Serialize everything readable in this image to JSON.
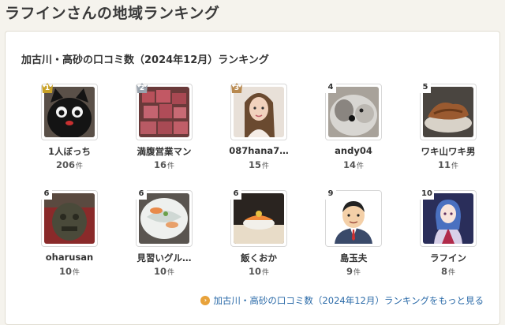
{
  "page": {
    "title": "ラフインさんの地域ランキング"
  },
  "panel": {
    "title": "加古川・高砂の口コミ数（2024年12月）ランキング",
    "more_link": "加古川・高砂の口コミ数（2024年12月）ランキングをもっと見る"
  },
  "colors": {
    "gold": "#c9a227",
    "silver": "#9aa3ad",
    "bronze": "#b8894f",
    "link": "#2a6aa8",
    "accent_orange": "#e8a23a"
  },
  "count_unit": "件",
  "rankings": [
    {
      "rank": "1",
      "medal": "gold",
      "name": "1人ぼっち",
      "count": "206",
      "avatar": "black-cat-photo"
    },
    {
      "rank": "2",
      "medal": "silver",
      "name": "満腹営業マン",
      "count": "16",
      "avatar": "raw-meat-cubes-photo"
    },
    {
      "rank": "3",
      "medal": "bronze",
      "name": "087hana7…",
      "count": "15",
      "avatar": "woman-portrait-photo"
    },
    {
      "rank": "4",
      "medal": "",
      "name": "andy04",
      "count": "14",
      "avatar": "gray-dog-photo"
    },
    {
      "rank": "5",
      "medal": "",
      "name": "ワキ山ワキ男",
      "count": "11",
      "avatar": "grilled-meat-photo"
    },
    {
      "rank": "6",
      "medal": "",
      "name": "oharusan",
      "count": "10",
      "avatar": "lion-statue-photo"
    },
    {
      "rank": "6",
      "medal": "",
      "name": "見習いグル…",
      "count": "10",
      "avatar": "sashimi-plate-photo"
    },
    {
      "rank": "6",
      "medal": "",
      "name": "飯くおか",
      "count": "10",
      "avatar": "sushi-photo"
    },
    {
      "rank": "9",
      "medal": "",
      "name": "島玉夫",
      "count": "9",
      "avatar": "businessman-illustration"
    },
    {
      "rank": "10",
      "medal": "",
      "name": "ラフイン",
      "count": "8",
      "avatar": "anime-kimono-girl-illustration"
    }
  ]
}
